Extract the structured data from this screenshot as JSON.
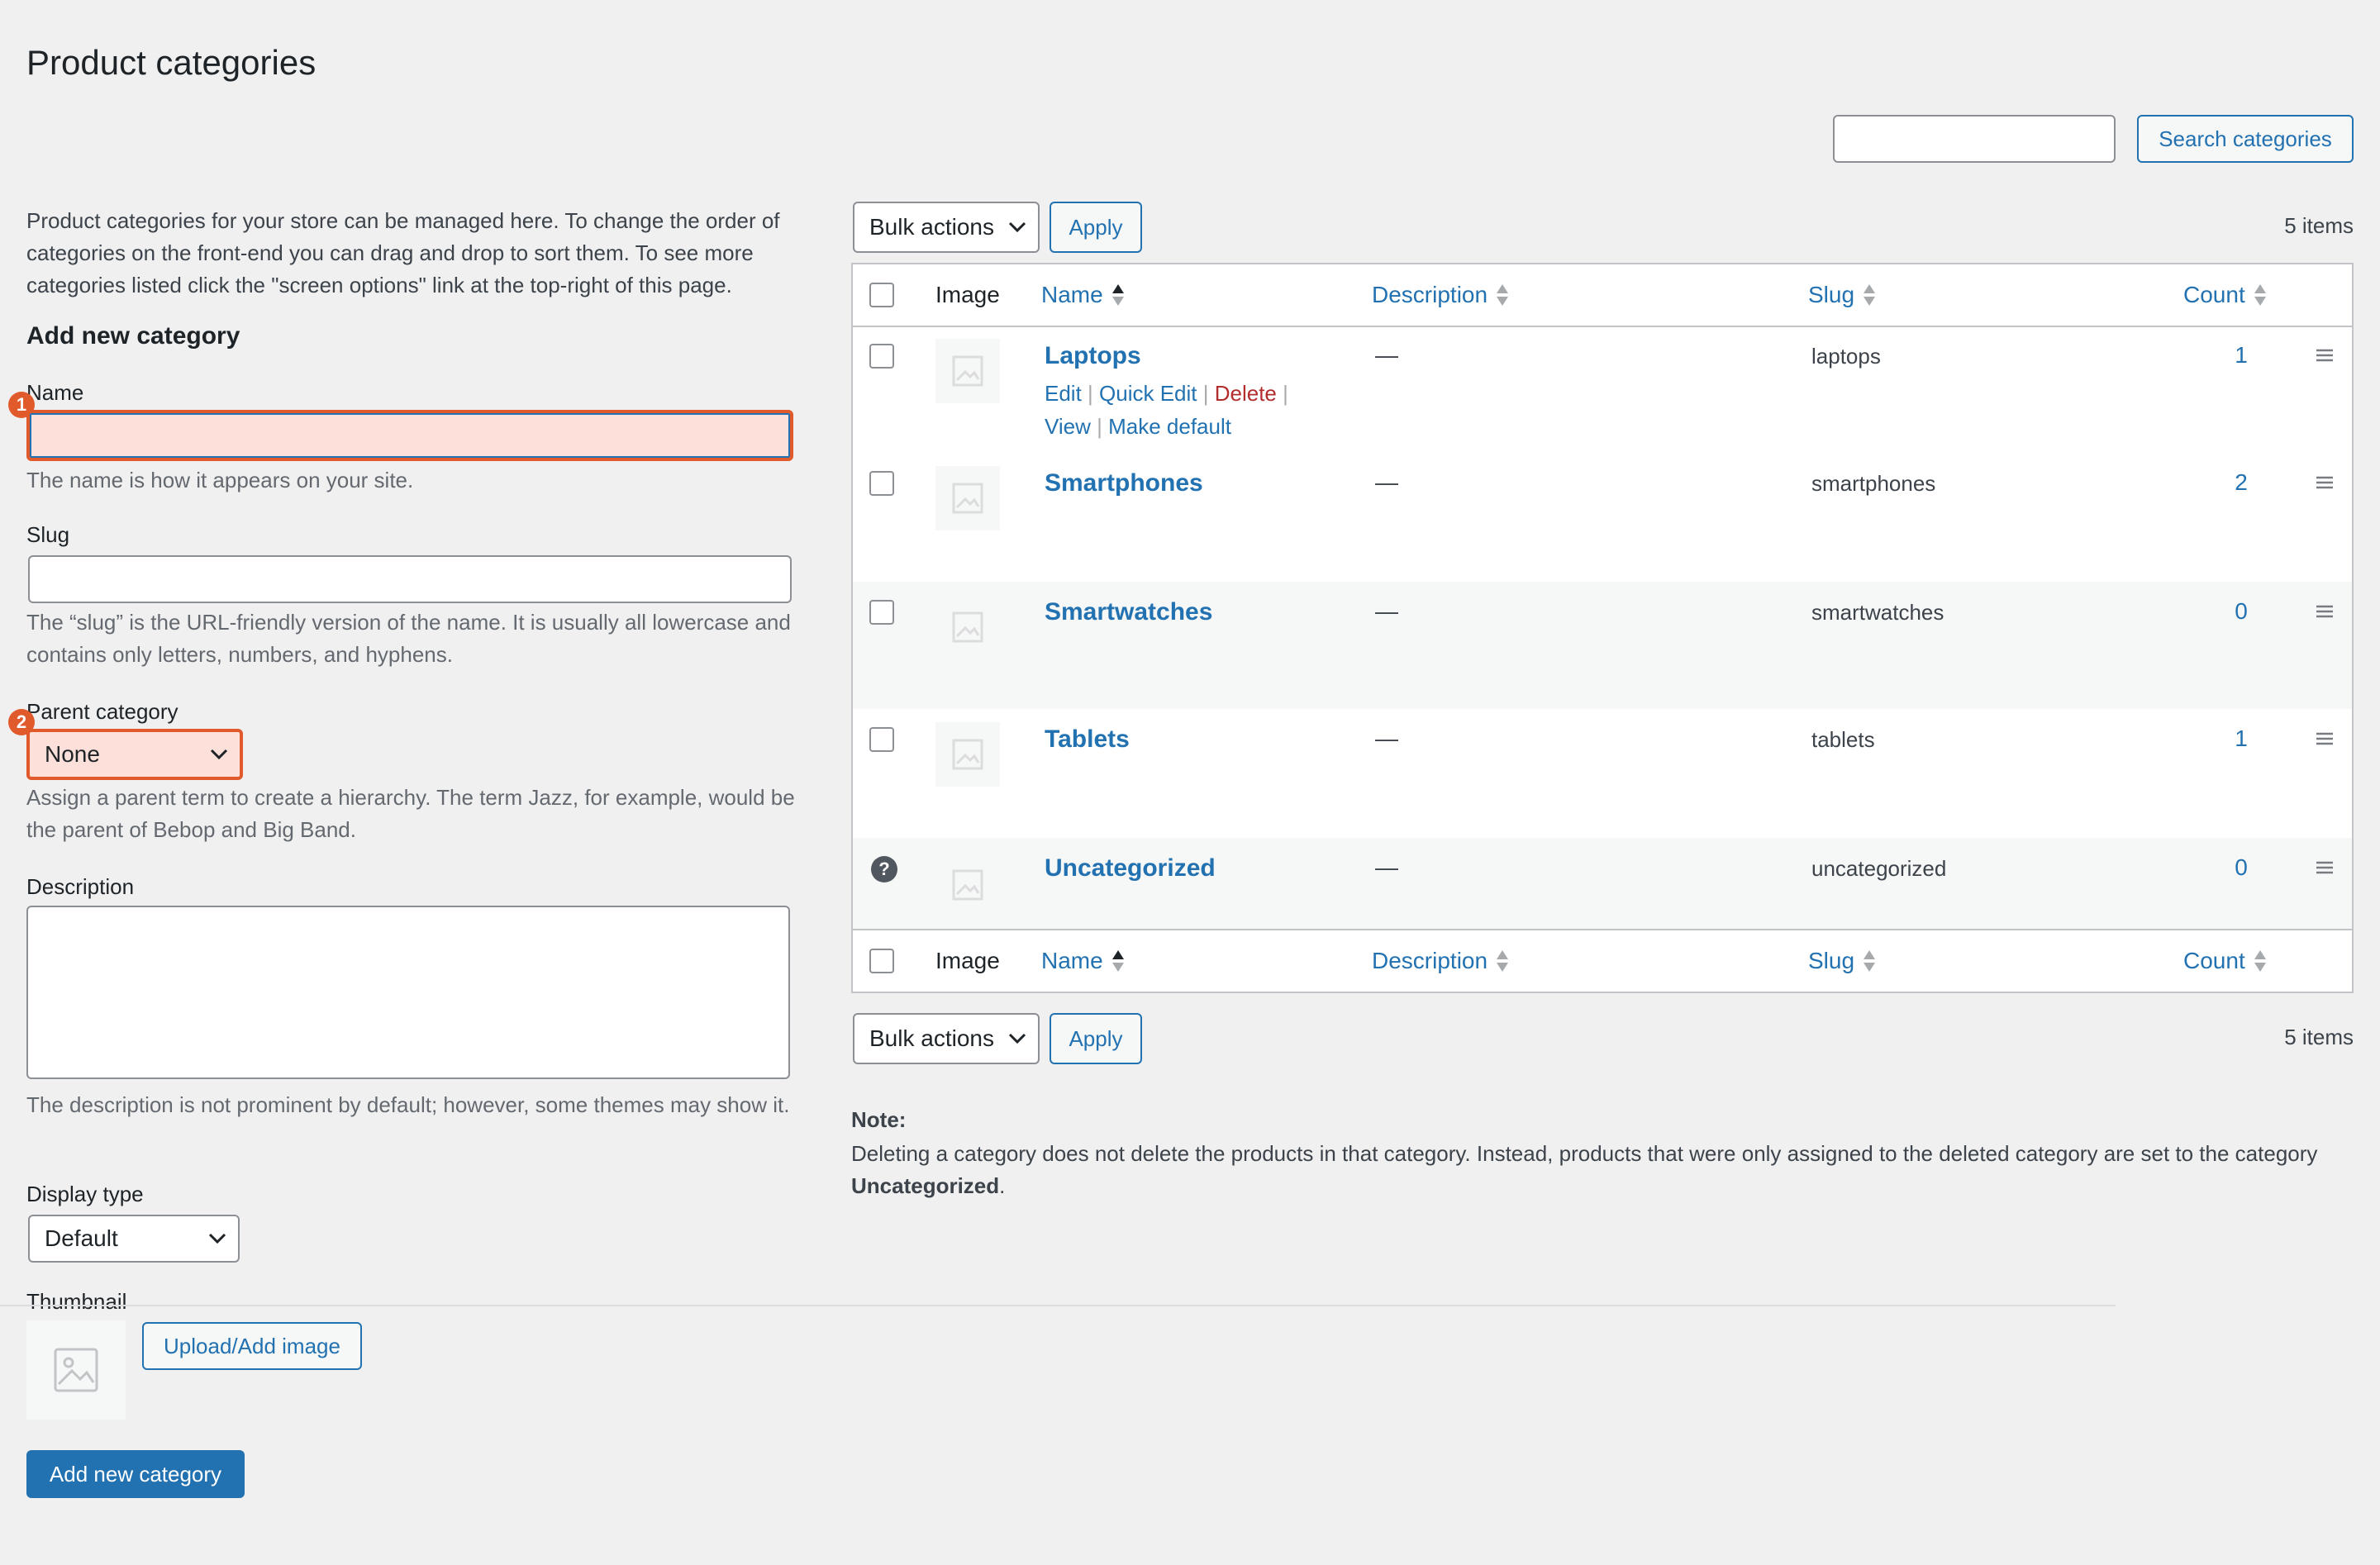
{
  "page": {
    "title": "Product categories"
  },
  "search": {
    "button_label": "Search categories",
    "value": ""
  },
  "add_form": {
    "intro": "Product categories for your store can be managed here. To change the order of categories on the front-end you can drag and drop to sort them. To see more categories listed click the \"screen options\" link at the top-right of this page.",
    "section_title": "Add new category",
    "name_label": "Name",
    "name_help": "The name is how it appears on your site.",
    "name_badge": "1",
    "slug_label": "Slug",
    "slug_help": "The “slug” is the URL-friendly version of the name. It is usually all lowercase and contains only letters, numbers, and hyphens.",
    "parent_label": "Parent category",
    "parent_value": "None",
    "parent_badge": "2",
    "parent_help": "Assign a parent term to create a hierarchy. The term Jazz, for example, would be the parent of Bebop and Big Band.",
    "description_label": "Description",
    "description_help": "The description is not prominent by default; however, some themes may show it.",
    "display_type_label": "Display type",
    "display_type_value": "Default",
    "thumbnail_label": "Thumbnail",
    "upload_button": "Upload/Add image",
    "submit_button": "Add new category"
  },
  "list": {
    "bulk_actions": "Bulk actions",
    "apply": "Apply",
    "items_count": "5 items",
    "columns": {
      "image": "Image",
      "name": "Name",
      "description": "Description",
      "slug": "Slug",
      "count": "Count"
    },
    "rows": [
      {
        "name": "Laptops",
        "description": "—",
        "slug": "laptops",
        "count": "1",
        "actions": {
          "edit": "Edit",
          "quick_edit": "Quick Edit",
          "delete": "Delete",
          "view": "View",
          "make_default": "Make default"
        }
      },
      {
        "name": "Smartphones",
        "description": "—",
        "slug": "smartphones",
        "count": "2"
      },
      {
        "name": "Smartwatches",
        "description": "—",
        "slug": "smartwatches",
        "count": "0"
      },
      {
        "name": "Tablets",
        "description": "—",
        "slug": "tablets",
        "count": "1"
      },
      {
        "name": "Uncategorized",
        "description": "—",
        "slug": "uncategorized",
        "count": "0",
        "help_icon": "?"
      }
    ],
    "note_title": "Note:",
    "note_text_before": "Deleting a category does not delete the products in that category. Instead, products that were only assigned to the deleted category are set to the category ",
    "note_text_bold": "Uncategorized",
    "note_text_after": "."
  },
  "colors": {
    "accent": "#2271b1",
    "highlight_border": "#e05a2b",
    "highlight_fill": "#fde0d9",
    "danger": "#b32d2e"
  }
}
